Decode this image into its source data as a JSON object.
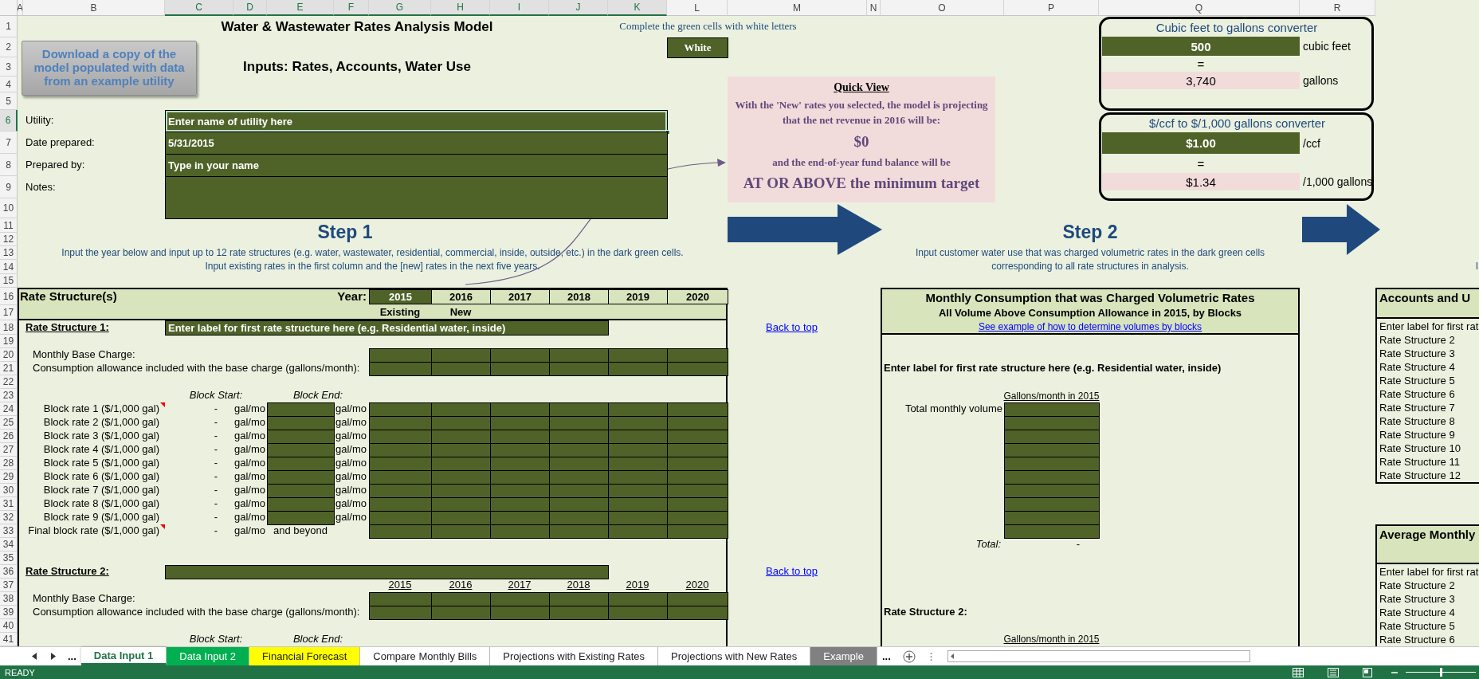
{
  "column_headers": [
    {
      "label": "A",
      "selected": false
    },
    {
      "label": "B",
      "selected": false
    },
    {
      "label": "C",
      "selected": true
    },
    {
      "label": "D",
      "selected": true
    },
    {
      "label": "E",
      "selected": true
    },
    {
      "label": "F",
      "selected": true
    },
    {
      "label": "G",
      "selected": true
    },
    {
      "label": "H",
      "selected": true
    },
    {
      "label": "I",
      "selected": true
    },
    {
      "label": "J",
      "selected": true
    },
    {
      "label": "K",
      "selected": true
    },
    {
      "label": "L",
      "selected": false
    },
    {
      "label": "M",
      "selected": false
    },
    {
      "label": "N",
      "selected": false
    },
    {
      "label": "O",
      "selected": false
    },
    {
      "label": "P",
      "selected": false
    },
    {
      "label": "Q",
      "selected": false
    },
    {
      "label": "R",
      "selected": false
    }
  ],
  "row_numbers": [
    {
      "label": "1",
      "selected": false
    },
    {
      "label": "2",
      "selected": false
    },
    {
      "label": "3",
      "selected": false
    },
    {
      "label": "4",
      "selected": false
    },
    {
      "label": "5",
      "selected": false
    },
    {
      "label": "6",
      "selected": true
    },
    {
      "label": "7",
      "selected": false
    },
    {
      "label": "8",
      "selected": false
    },
    {
      "label": "9",
      "selected": false
    },
    {
      "label": "10",
      "selected": false
    },
    {
      "label": "11",
      "selected": false
    },
    {
      "label": "12",
      "selected": false
    },
    {
      "label": "13",
      "selected": false
    },
    {
      "label": "14",
      "selected": false
    },
    {
      "label": "15",
      "selected": false
    },
    {
      "label": "16",
      "selected": false
    },
    {
      "label": "17",
      "selected": false
    },
    {
      "label": "18",
      "selected": false
    },
    {
      "label": "19",
      "selected": false
    },
    {
      "label": "20",
      "selected": false
    },
    {
      "label": "21",
      "selected": false
    },
    {
      "label": "22",
      "selected": false
    },
    {
      "label": "23",
      "selected": false
    },
    {
      "label": "24",
      "selected": false
    },
    {
      "label": "25",
      "selected": false
    },
    {
      "label": "26",
      "selected": false
    },
    {
      "label": "27",
      "selected": false
    },
    {
      "label": "28",
      "selected": false
    },
    {
      "label": "29",
      "selected": false
    },
    {
      "label": "30",
      "selected": false
    },
    {
      "label": "31",
      "selected": false
    },
    {
      "label": "32",
      "selected": false
    },
    {
      "label": "33",
      "selected": false
    },
    {
      "label": "34",
      "selected": false
    },
    {
      "label": "35",
      "selected": false
    },
    {
      "label": "36",
      "selected": false
    },
    {
      "label": "37",
      "selected": false
    },
    {
      "label": "38",
      "selected": false
    },
    {
      "label": "39",
      "selected": false
    },
    {
      "label": "40",
      "selected": false
    },
    {
      "label": "41",
      "selected": false
    }
  ],
  "title": "Water & Wastewater Rates Analysis Model",
  "legend": {
    "text": "Complete the green cells with white letters",
    "swatch": "White"
  },
  "download_button": "Download a copy of the model populated with data from an example utility",
  "subtitle": "Inputs: Rates, Accounts, Water Use",
  "info_fields": [
    {
      "label": "Utility:",
      "value": "Enter name of utility here",
      "selected": true
    },
    {
      "label": "Date prepared:",
      "value": "5/31/2015",
      "selected": false
    },
    {
      "label": "Prepared by:",
      "value": "Type in your name",
      "selected": false
    },
    {
      "label": "Notes:",
      "selected": false
    }
  ],
  "quick_view": {
    "title": "Quick View",
    "line_1": "With the 'New' rates you selected, the model is projecting that the net revenue in 2016 will be:",
    "amount": "$0",
    "line_2": "and the end-of-year fund balance will be",
    "status": "AT OR ABOVE the minimum target"
  },
  "converters": [
    {
      "title": "Cubic feet to gallons converter",
      "input": "500",
      "input_unit": "cubic feet",
      "equals": "=",
      "output": "3,740",
      "output_unit": "gallons"
    },
    {
      "title": "$/ccf to $/1,000 gallons converter",
      "input": "$1.00",
      "input_unit": "/ccf",
      "equals": "=",
      "output": "$1.34",
      "output_unit": "/1,000 gallons"
    }
  ],
  "step_1": {
    "title": "Step 1",
    "lines": [
      "Input the year below and input up to 12 rate structures (e.g. water, wastewater, residential, commercial, inside, outside, etc.) in the dark green cells.",
      "Input existing rates in the first column and the [new] rates in the next five years."
    ]
  },
  "step_2": {
    "title": "Step 2",
    "lines": [
      "Input customer water use that was charged volumetric rates in the dark green cells",
      "corresponding to all rate structures in analysis."
    ]
  },
  "step_3_fragment": "I",
  "rate_table": {
    "title": "Rate Structure(s)",
    "year_label": "Year:",
    "years": [
      {
        "label": "2015",
        "selected": true
      },
      {
        "label": "2016",
        "selected": false
      },
      {
        "label": "2017",
        "selected": false
      },
      {
        "label": "2018",
        "selected": false
      },
      {
        "label": "2019",
        "selected": false
      },
      {
        "label": "2020",
        "selected": false
      }
    ],
    "year_notes": [
      "Existing",
      "New"
    ],
    "structure_1": {
      "label": "Rate Structure 1:",
      "name": "Enter label for first rate structure here (e.g. Residential water, inside)",
      "base_charge": "Monthly Base Charge:",
      "allowance": "Consumption allowance included with the base charge (gallons/month):",
      "block_start": "Block Start:",
      "block_end": "Block End:",
      "blocks": [
        {
          "label": "Block rate 1 ($/1,000 gal)",
          "start": "-",
          "start_unit": "gal/mo",
          "end_unit": "gal/mo",
          "comment": true
        },
        {
          "label": "Block rate 2 ($/1,000 gal)",
          "start": "-",
          "start_unit": "gal/mo",
          "end_unit": "gal/mo",
          "comment": false
        },
        {
          "label": "Block rate 3 ($/1,000 gal)",
          "start": "-",
          "start_unit": "gal/mo",
          "end_unit": "gal/mo",
          "comment": false
        },
        {
          "label": "Block rate 4 ($/1,000 gal)",
          "start": "-",
          "start_unit": "gal/mo",
          "end_unit": "gal/mo",
          "comment": false
        },
        {
          "label": "Block rate 5 ($/1,000 gal)",
          "start": "-",
          "start_unit": "gal/mo",
          "end_unit": "gal/mo",
          "comment": false
        },
        {
          "label": "Block rate 6 ($/1,000 gal)",
          "start": "-",
          "start_unit": "gal/mo",
          "end_unit": "gal/mo",
          "comment": false
        },
        {
          "label": "Block rate 7 ($/1,000 gal)",
          "start": "-",
          "start_unit": "gal/mo",
          "end_unit": "gal/mo",
          "comment": false
        },
        {
          "label": "Block rate 8 ($/1,000 gal)",
          "start": "-",
          "start_unit": "gal/mo",
          "end_unit": "gal/mo",
          "comment": false
        },
        {
          "label": "Block rate 9 ($/1,000 gal)",
          "start": "-",
          "start_unit": "gal/mo",
          "end_unit": "gal/mo",
          "comment": false
        }
      ],
      "final_block": {
        "label": "Final block rate ($/1,000 gal)",
        "start": "-",
        "start_unit": "gal/mo",
        "end_text": "and beyond",
        "comment": true
      }
    },
    "structure_2": {
      "label": "Rate Structure 2:",
      "years": [
        "2015",
        "2016",
        "2017",
        "2018",
        "2019",
        "2020"
      ],
      "base_charge": "Monthly Base Charge:",
      "allowance": "Consumption allowance included with the base charge (gallons/month):",
      "block_start": "Block Start:",
      "block_end": "Block End:"
    }
  },
  "back_to_top_links": [
    "Back to top",
    "Back to top"
  ],
  "consumption": {
    "title": "Monthly Consumption that was Charged Volumetric Rates",
    "subtitle": "All Volume Above Consumption Allowance in 2015, by Blocks",
    "link": "See example of how to determine volumes by blocks",
    "section_1": {
      "label": "Enter label for first rate structure here (e.g. Residential water, inside)",
      "column_heading": "Gallons/month in 2015",
      "row_label": "Total monthly volume",
      "total_label": "Total:",
      "total": "-"
    },
    "section_2": {
      "label": "Rate Structure 2:",
      "column_heading": "Gallons/month in 2015"
    }
  },
  "accounts_panel": {
    "title": "Accounts and U",
    "items": [
      "Enter label for first rat",
      "Rate Structure 2",
      "Rate Structure 3",
      "Rate Structure 4",
      "Rate Structure 5",
      "Rate Structure 6",
      "Rate Structure 7",
      "Rate Structure 8",
      "Rate Structure 9",
      "Rate Structure 10",
      "Rate Structure 11",
      "Rate Structure 12"
    ]
  },
  "average_panel": {
    "title": "Average Monthly",
    "items": [
      "Enter label for first rat",
      "Rate Structure 2",
      "Rate Structure 3",
      "Rate Structure 4",
      "Rate Structure 5",
      "Rate Structure 6"
    ]
  },
  "sheet_tabs": [
    {
      "label": "Data Input 1",
      "selected": true,
      "color": "#217346"
    },
    {
      "label": "Data Input 2",
      "selected": false,
      "color": "#00b050"
    },
    {
      "label": "Financial Forecast",
      "selected": false,
      "color": "#ffff00"
    },
    {
      "label": "Compare Monthly Bills",
      "selected": false,
      "color": "#ffffff"
    },
    {
      "label": "Projections with Existing Rates",
      "selected": false,
      "color": "#ffffff"
    },
    {
      "label": "Projections with New Rates",
      "selected": false,
      "color": "#ffffff"
    },
    {
      "label": "Example",
      "selected": false,
      "color": "#808080"
    }
  ],
  "tab_overflow": [
    "...",
    "..."
  ],
  "status_bar": {
    "mode": "READY",
    "zoom_slider": {
      "level": 0.5
    }
  }
}
